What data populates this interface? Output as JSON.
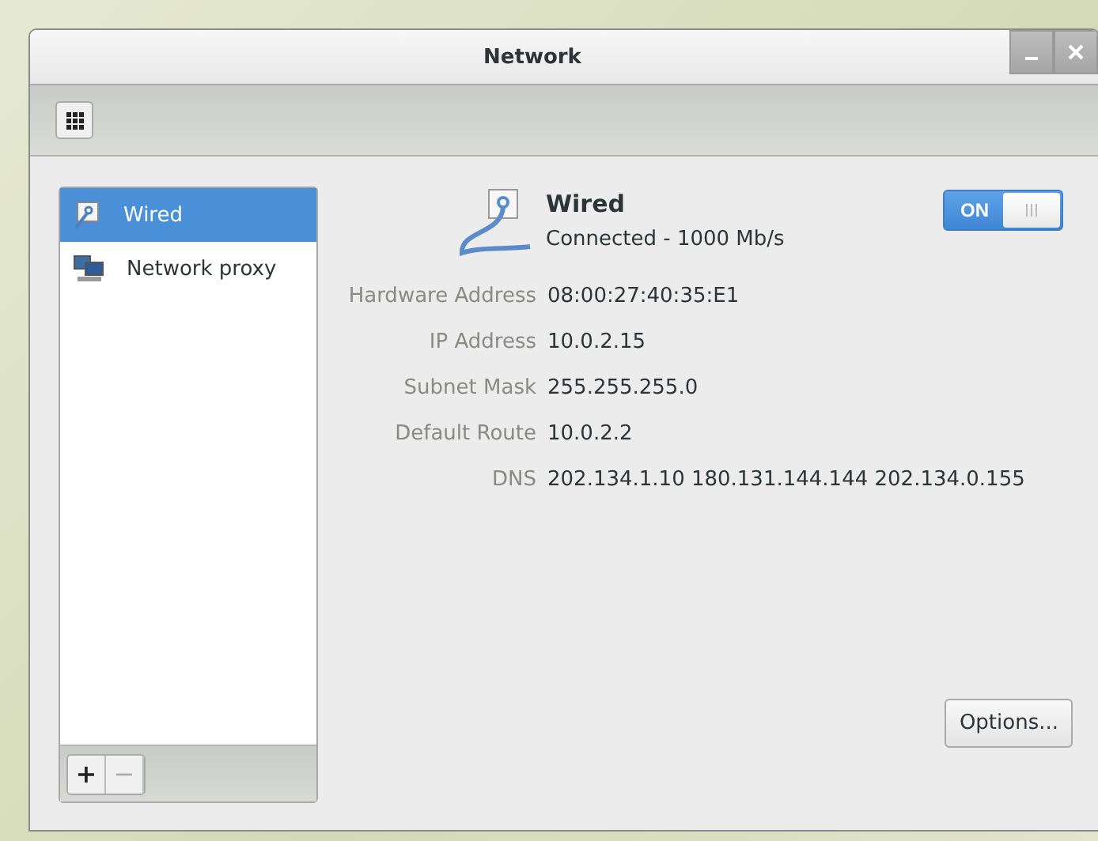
{
  "window": {
    "title": "Network"
  },
  "sidebar": {
    "items": [
      {
        "label": "Wired",
        "kind": "wired",
        "selected": true
      },
      {
        "label": "Network proxy",
        "kind": "proxy",
        "selected": false
      }
    ],
    "add_button": {
      "label": "+",
      "disabled": false
    },
    "remove_button": {
      "label": "−",
      "disabled": true
    }
  },
  "connection": {
    "name": "Wired",
    "status": "Connected - 1000 Mb/s",
    "switch": {
      "label": "ON",
      "on": true
    }
  },
  "details": [
    {
      "label": "Hardware Address",
      "value": "08:00:27:40:35:E1"
    },
    {
      "label": "IP Address",
      "value": "10.0.2.15"
    },
    {
      "label": "Subnet Mask",
      "value": "255.255.255.0"
    },
    {
      "label": "Default Route",
      "value": "10.0.2.2"
    },
    {
      "label": "DNS",
      "value": "202.134.1.10 180.131.144.144 202.134.0.155"
    }
  ],
  "buttons": [
    {
      "label": "Options..."
    }
  ]
}
